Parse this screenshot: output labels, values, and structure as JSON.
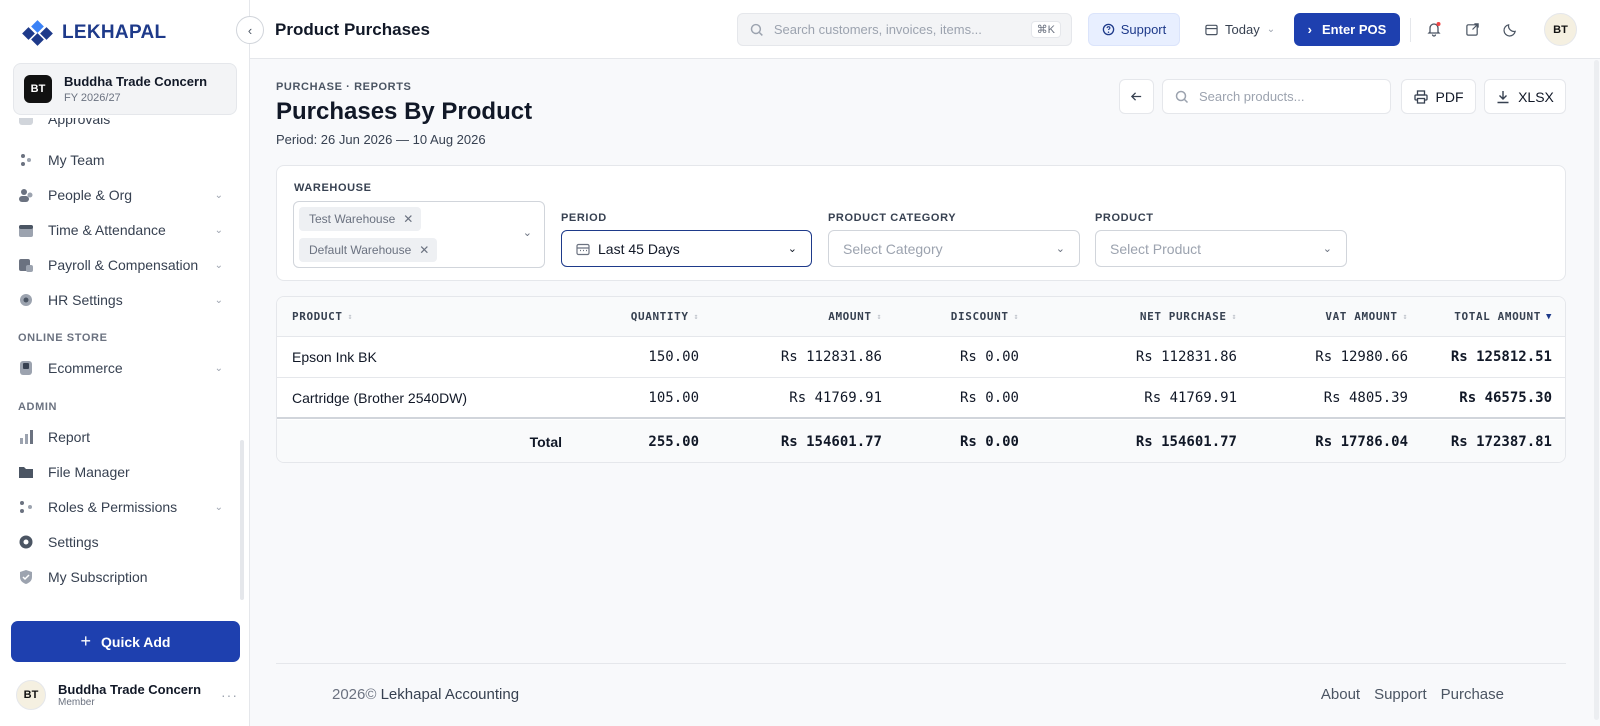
{
  "brand": {
    "name": "LEKHAPAL"
  },
  "org": {
    "initials": "BT",
    "name": "Buddha Trade Concern",
    "fy": "FY 2026/27"
  },
  "sidebar": {
    "partial_item": "Approvals",
    "items": [
      {
        "label": "My Team",
        "icon": "team-icon",
        "has_children": false
      },
      {
        "label": "People & Org",
        "icon": "people-icon",
        "has_children": true
      },
      {
        "label": "Time & Attendance",
        "icon": "calendar-icon",
        "has_children": true
      },
      {
        "label": "Payroll & Compensation",
        "icon": "payroll-icon",
        "has_children": true
      },
      {
        "label": "HR Settings",
        "icon": "gear-icon",
        "has_children": true
      }
    ],
    "section_store": "ONLINE STORE",
    "store_items": [
      {
        "label": "Ecommerce",
        "icon": "store-icon",
        "has_children": true
      }
    ],
    "section_admin": "ADMIN",
    "admin_items": [
      {
        "label": "Report",
        "icon": "bar-chart-icon",
        "has_children": false
      },
      {
        "label": "File Manager",
        "icon": "folder-icon",
        "has_children": false
      },
      {
        "label": "Roles & Permissions",
        "icon": "roles-icon",
        "has_children": true
      },
      {
        "label": "Settings",
        "icon": "settings-icon",
        "has_children": false
      },
      {
        "label": "My Subscription",
        "icon": "shield-icon",
        "has_children": false
      }
    ],
    "quick_add": "Quick Add"
  },
  "user": {
    "initials": "BT",
    "name": "Buddha Trade Concern",
    "role": "Member"
  },
  "topbar": {
    "title": "Product Purchases",
    "search_placeholder": "Search customers, invoices, items...",
    "shortcut": "⌘K",
    "support": "Support",
    "date_range": "Today",
    "enter_pos": "Enter POS",
    "avatar": "BT"
  },
  "page": {
    "breadcrumb": "PURCHASE · REPORTS",
    "title": "Purchases By Product",
    "period": "Period: 26 Jun 2026 — 10 Aug 2026",
    "search_placeholder": "Search products...",
    "pdf": "PDF",
    "xlsx": "XLSX"
  },
  "filters": {
    "warehouse_label": "WAREHOUSE",
    "warehouses": [
      "Test Warehouse",
      "Default Warehouse"
    ],
    "period_label": "PERIOD",
    "period_value": "Last 45 Days",
    "category_label": "PRODUCT CATEGORY",
    "category_placeholder": "Select Category",
    "product_label": "PRODUCT",
    "product_placeholder": "Select Product"
  },
  "table": {
    "columns": [
      "PRODUCT",
      "QUANTITY",
      "AMOUNT",
      "DISCOUNT",
      "NET PURCHASE",
      "VAT AMOUNT",
      "TOTAL AMOUNT"
    ],
    "rows": [
      {
        "product": "Epson Ink BK",
        "quantity": "150.00",
        "amount": "Rs 112831.86",
        "discount": "Rs 0.00",
        "net": "Rs 112831.86",
        "vat": "Rs 12980.66",
        "total": "Rs 125812.51"
      },
      {
        "product": "Cartridge (Brother 2540DW)",
        "quantity": "105.00",
        "amount": "Rs 41769.91",
        "discount": "Rs 0.00",
        "net": "Rs 41769.91",
        "vat": "Rs 4805.39",
        "total": "Rs 46575.30"
      }
    ],
    "totals": {
      "label": "Total",
      "quantity": "255.00",
      "amount": "Rs 154601.77",
      "discount": "Rs 0.00",
      "net": "Rs 154601.77",
      "vat": "Rs 17786.04",
      "total": "Rs 172387.81"
    }
  },
  "footer": {
    "year": "2026©",
    "company": "Lekhapal Accounting",
    "links": [
      "About",
      "Support",
      "Purchase"
    ]
  },
  "colors": {
    "primary": "#1e40af",
    "brand": "#1e3a8a"
  }
}
